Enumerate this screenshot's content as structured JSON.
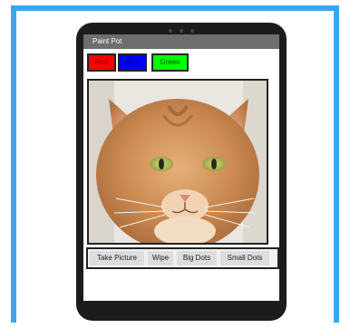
{
  "app": {
    "title": "Paint Pot"
  },
  "colors": {
    "frame_blue": "#3aa6f2",
    "device_body": "#1c1c1c",
    "titlebar": "#6e6e6e"
  },
  "color_buttons": [
    {
      "label": "Red",
      "color": "#ff0000"
    },
    {
      "label": "Blue",
      "color": "#0000ff"
    },
    {
      "label": "Green",
      "color": "#00ff00"
    }
  ],
  "canvas": {
    "image": "orange tabby cat face"
  },
  "actions": [
    {
      "label": "Take Picture"
    },
    {
      "label": "Wipe"
    },
    {
      "label": "Big Dots"
    },
    {
      "label": "Small Dots"
    }
  ]
}
